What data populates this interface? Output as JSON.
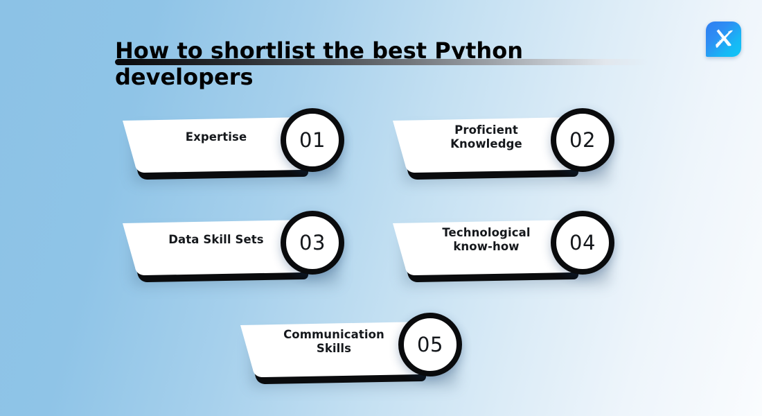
{
  "header": {
    "title": "How to shortlist the best Python developers",
    "underline_gradient_from": "#08090b",
    "underline_gradient_to": "#f0f5fa"
  },
  "logo": {
    "name": "brand-logo",
    "icon": "x-swoosh-icon",
    "tile_gradient_from": "#2f7ef0",
    "tile_gradient_to": "#0fc6f7",
    "mark_color": "#ffffff"
  },
  "background": {
    "gradient_from": "#8cc2e6",
    "gradient_to": "#fafcfe"
  },
  "theme": {
    "card_fill": "#ffffff",
    "card_shadow": "#0a0b0d",
    "text_color": "#15181c",
    "number_ring_color": "#0a0b0d"
  },
  "cards": [
    {
      "number": "01",
      "label": "Expertise",
      "lines": [
        "Expertise"
      ]
    },
    {
      "number": "02",
      "label": "Proficient Knowledge",
      "lines": [
        "Proficient",
        "Knowledge"
      ]
    },
    {
      "number": "03",
      "label": "Data Skill Sets",
      "lines": [
        "Data Skill Sets"
      ]
    },
    {
      "number": "04",
      "label": "Technological know-how",
      "lines": [
        "Technological",
        "know-how"
      ]
    },
    {
      "number": "05",
      "label": "Communication Skills",
      "lines": [
        "Communication",
        "Skills"
      ]
    }
  ]
}
